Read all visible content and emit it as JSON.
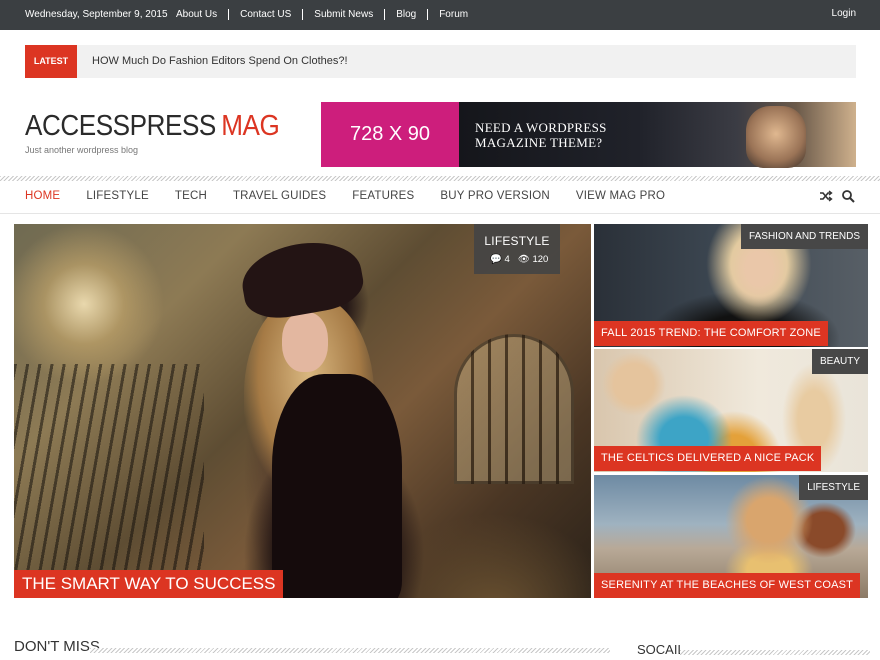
{
  "topbar": {
    "date": "Wednesday, September 9, 2015",
    "links": [
      "About Us",
      "Contact US",
      "Submit News",
      "Blog",
      "Forum"
    ],
    "login": "Login"
  },
  "ticker": {
    "badge": "LATEST",
    "headline": "HOW Much Do Fashion Editors Spend On Clothes?!"
  },
  "site": {
    "name_part1": "ACCESSPRESS",
    "name_part2": "MAG",
    "tagline": "Just another wordpress blog"
  },
  "banner": {
    "size_label": "728 X 90",
    "text": "NEED A WORDPRESS MAGAZINE THEME?"
  },
  "nav": {
    "items": [
      "HOME",
      "LIFESTYLE",
      "TECH",
      "TRAVEL GUIDES",
      "FEATURES",
      "BUY PRO VERSION",
      "VIEW MAG PRO"
    ],
    "active_index": 0,
    "icons": [
      "shuffle-icon",
      "search-icon"
    ]
  },
  "featured": {
    "category": "LIFESTYLE",
    "comments": "4",
    "views": "120",
    "title": "THE SMART WAY TO SUCCESS"
  },
  "side_posts": [
    {
      "category": "FASHION AND TRENDS",
      "title": "FALL 2015 TREND: THE COMFORT ZONE"
    },
    {
      "category": "BEAUTY",
      "title": "THE CELTICS DELIVERED A NICE PACK"
    },
    {
      "category": "LIFESTYLE",
      "title": "SERENITY AT THE BEACHES OF WEST COAST"
    }
  ],
  "sections": {
    "dont_miss": "DON'T MISS",
    "social": "SOCAIL"
  },
  "colors": {
    "accent": "#dc3522",
    "topbar": "#3b3f42",
    "banner_pink": "#cd1e7c"
  }
}
